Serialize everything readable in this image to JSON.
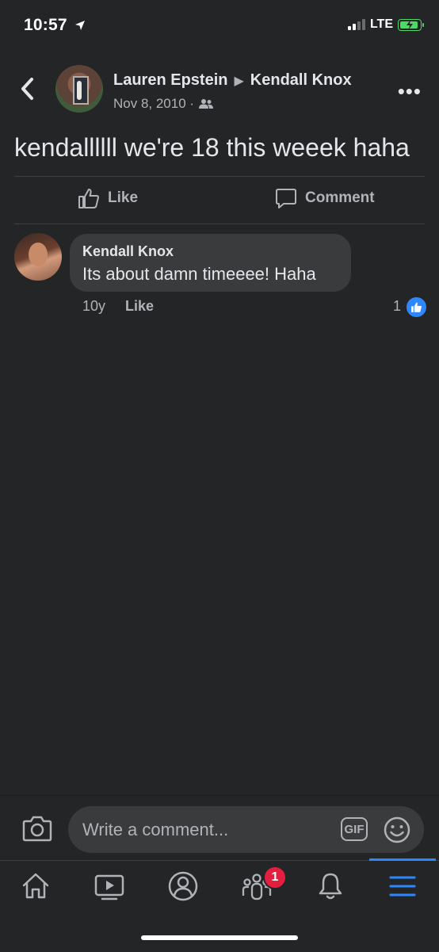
{
  "status_bar": {
    "time": "10:57",
    "network": "LTE"
  },
  "post": {
    "author": "Lauren Epstein",
    "target": "Kendall Knox",
    "date": "Nov 8, 2010 ·",
    "text": "kendallllll we're 18 this weeek haha"
  },
  "actions": {
    "like_label": "Like",
    "comment_label": "Comment"
  },
  "comment": {
    "author": "Kendall Knox",
    "text": "Its about damn timeeee! Haha",
    "age": "10y",
    "like_label": "Like",
    "reaction_count": "1"
  },
  "composer": {
    "placeholder": "Write a comment...",
    "gif_label": "GIF"
  },
  "nav": {
    "groups_badge": "1"
  },
  "colors": {
    "background": "#242526",
    "accent": "#2d88ff",
    "badge": "#e41e3f"
  }
}
